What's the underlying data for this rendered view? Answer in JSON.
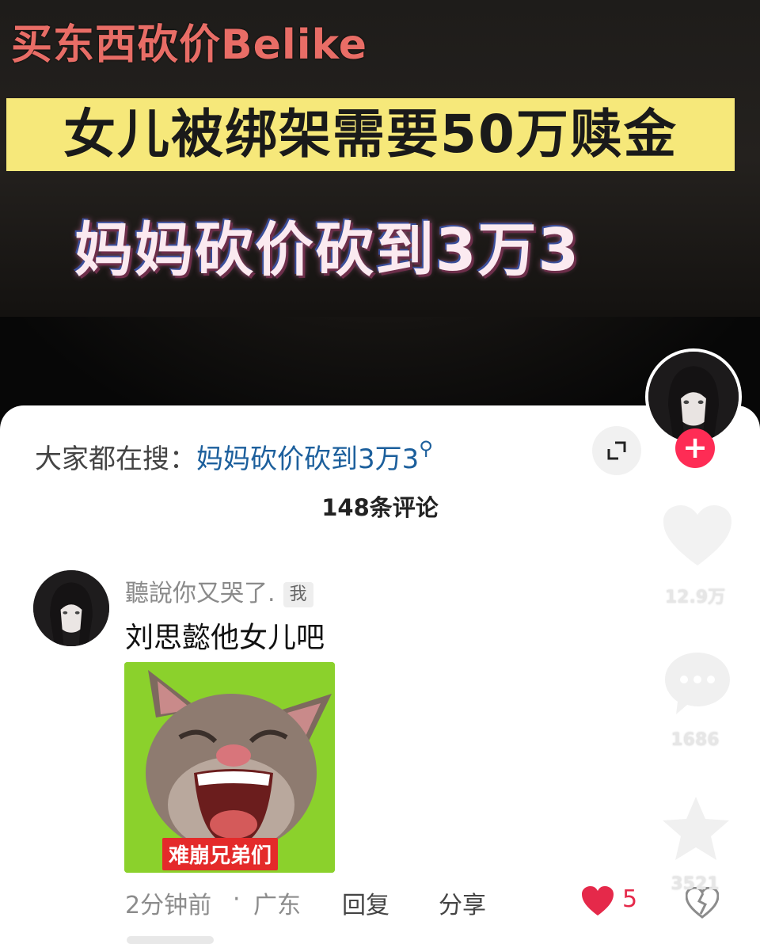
{
  "video": {
    "top_title": "买东西砍价Belike",
    "headline": "女儿被绑架需要50万赎金",
    "subline": "妈妈砍价砍到3万3"
  },
  "side_actions": {
    "likes": "12.9万",
    "comments": "1686",
    "favorites": "3521",
    "follow_symbol": "+"
  },
  "hot_search": {
    "label": "大家都在搜：",
    "query": "妈妈砍价砍到3万3",
    "query_icon": "search-icon"
  },
  "comments_header": {
    "count_text": "148条评论"
  },
  "comment": {
    "username": "聽說你又哭了.",
    "tag": "我",
    "text": "刘思懿他女儿吧",
    "sticker_caption": "难崩兄弟们",
    "time": "2分钟前",
    "separator": "·",
    "location": "广东",
    "reply_label": "回复",
    "share_label": "分享",
    "like_count": "5"
  },
  "colors": {
    "accent_red": "#fe2c55",
    "link_blue": "#1c5f9c",
    "headline_bg": "#f6e87a",
    "title_top": "#e86d66",
    "sticker_bg": "#8bd12c"
  }
}
